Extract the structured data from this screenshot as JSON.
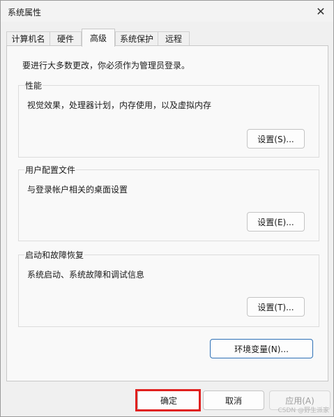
{
  "window": {
    "title": "系统属性"
  },
  "tabs": [
    {
      "label": "计算机名",
      "active": false
    },
    {
      "label": "硬件",
      "active": false
    },
    {
      "label": "高级",
      "active": true
    },
    {
      "label": "系统保护",
      "active": false
    },
    {
      "label": "远程",
      "active": false
    }
  ],
  "intro": "要进行大多数更改，你必须作为管理员登录。",
  "groups": {
    "performance": {
      "label": "性能",
      "desc": "视觉效果，处理器计划，内存使用，以及虚拟内存",
      "button": "设置(S)..."
    },
    "profile": {
      "label": "用户配置文件",
      "desc": "与登录帐户相关的桌面设置",
      "button": "设置(E)..."
    },
    "startup": {
      "label": "启动和故障恢复",
      "desc": "系统启动、系统故障和调试信息",
      "button": "设置(T)..."
    }
  },
  "env_button": "环境变量(N)...",
  "footer": {
    "ok": "确定",
    "cancel": "取消",
    "apply": "应用(A)"
  },
  "watermark": "CSDN @野生派家",
  "colors": {
    "highlight": "#e0201e",
    "accent_border": "#2c6fb6"
  }
}
